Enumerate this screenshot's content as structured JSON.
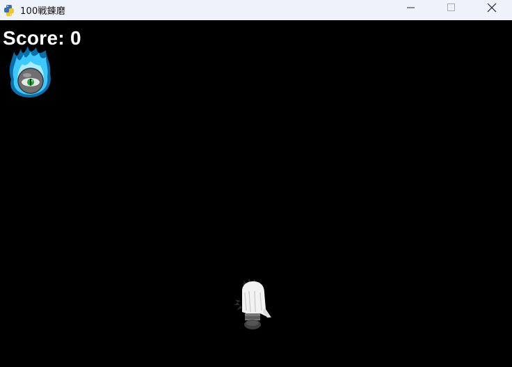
{
  "window": {
    "title": "100戦錬磨"
  },
  "titlebar_icons": {
    "app": "python-snake-icon",
    "minimize": "minimize-icon",
    "maximize": "maximize-icon",
    "close": "close-icon"
  },
  "hud": {
    "score_label": "Score:",
    "score_value": "0"
  },
  "sprites": {
    "enemy": "blue-flame-eyeball-sprite",
    "player": "white-haired-ghost-sprite"
  },
  "colors": {
    "titlebar_bg": "#eef2fa",
    "game_bg": "#000000",
    "score_text": "#ffffff",
    "enemy_flame": "#3fc7ff",
    "enemy_eye": "#1fa83a"
  }
}
